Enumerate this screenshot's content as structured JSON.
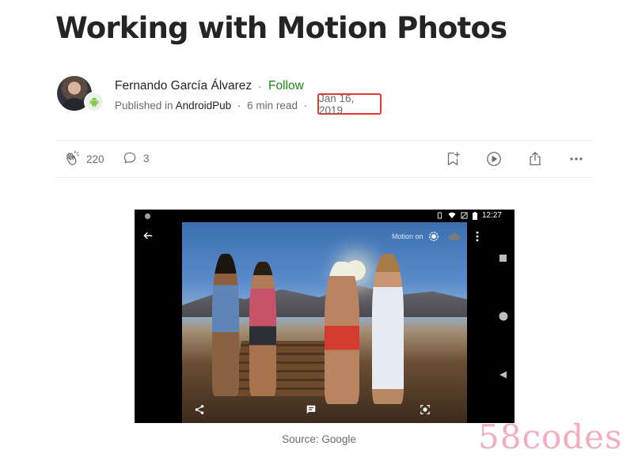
{
  "article": {
    "title": "Working with Motion Photos",
    "author": "Fernando García Álvarez",
    "follow_label": "Follow",
    "published_prefix": "Published in",
    "publication": "AndroidPub",
    "read_time": "6 min read",
    "date": "Jan 16, 2019",
    "separator": "·"
  },
  "actions": {
    "claps": "220",
    "responses": "3"
  },
  "video": {
    "status_time": "12:27",
    "motion_label": "Motion on"
  },
  "caption": "Source: Google",
  "watermark": "58codes",
  "colors": {
    "follow": "#1a8917",
    "highlight_box": "#e23b2a",
    "muted_text": "#6b6b6b",
    "watermark": "#f1a6b8"
  }
}
